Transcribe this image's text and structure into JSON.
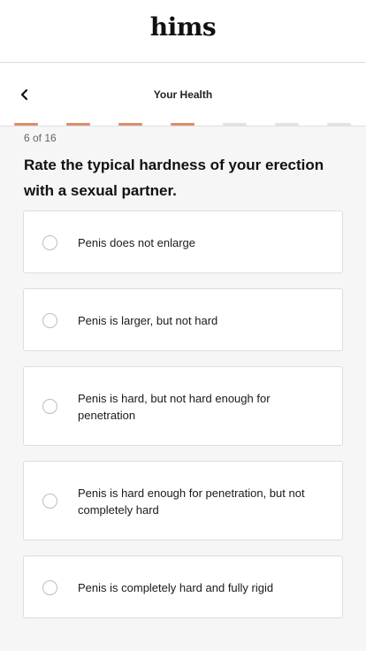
{
  "brand": {
    "logo_text": "hims"
  },
  "nav": {
    "back_icon": "chevron-left-icon",
    "title": "Your Health"
  },
  "progress": {
    "current_step": 6,
    "total_steps": 16,
    "step_label": "6 of 16",
    "filled_color": "#d98f6c",
    "empty_color": "#e3e3e3"
  },
  "question": {
    "text": "Rate the typical hardness of your erection with a sexual partner."
  },
  "options": [
    {
      "label": "Penis does not enlarge"
    },
    {
      "label": "Penis is larger, but not hard"
    },
    {
      "label": "Penis is hard, but not hard enough for penetration"
    },
    {
      "label": "Penis is hard enough for penetration, but not completely hard"
    },
    {
      "label": "Penis is completely hard and fully rigid"
    }
  ]
}
